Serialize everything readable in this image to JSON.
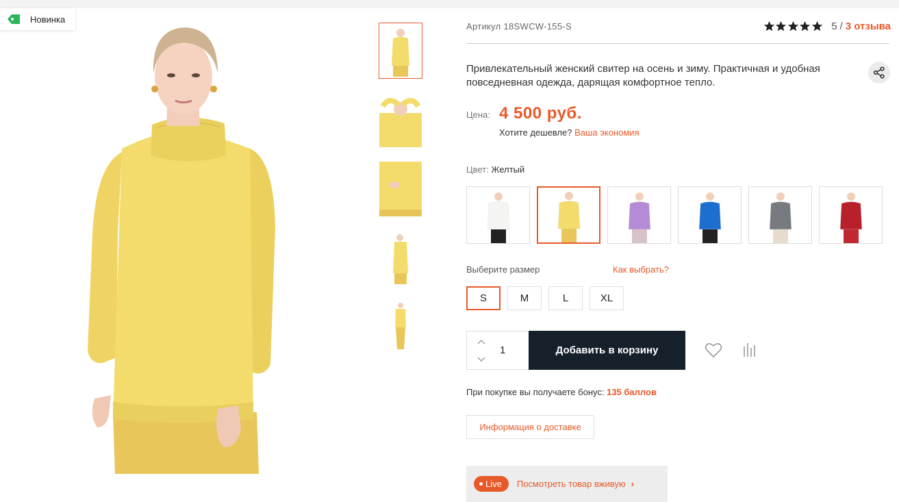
{
  "badge": {
    "label": "Новинка"
  },
  "product": {
    "sku": "Артикул 18SWCW-155-S",
    "rating": {
      "stars": 5,
      "score": "5",
      "separator": "/",
      "reviews": "3 отзыва"
    },
    "description": "Привлекательный женский свитер на осень и зиму. Практичная и удобная повседневная одежда, дарящая комфортное тепло.",
    "price_label": "Цена:",
    "price": "4 500 руб.",
    "cheaper_text": "Хотите дешевле?",
    "cheaper_link": "Ваша экономия",
    "color_label": "Цвет:",
    "color_value": "Желтый",
    "colors": [
      {
        "name": "white",
        "hex": "#f4f4f2",
        "active": false
      },
      {
        "name": "yellow",
        "hex": "#f3dc6b",
        "active": true
      },
      {
        "name": "lilac",
        "hex": "#b68ad6",
        "active": false
      },
      {
        "name": "blue",
        "hex": "#1d6fcf",
        "active": false
      },
      {
        "name": "grey",
        "hex": "#777a7e",
        "active": false
      },
      {
        "name": "red",
        "hex": "#b8202c",
        "active": false
      }
    ],
    "size_label": "Выберите размер",
    "size_guide": "Как выбрать?",
    "sizes": [
      "S",
      "M",
      "L",
      "XL"
    ],
    "selected_size": "S",
    "quantity": "1",
    "add_to_cart": "Добавить в корзину",
    "bonus_text": "При покупке вы получаете бонус:",
    "bonus_value": "135 баллов",
    "delivery_info": "Информация о доставке",
    "live_badge": "Live",
    "live_text": "Посмотреть товар вживую",
    "live_chevron": "›"
  },
  "colors": {
    "accent": "#e8592a",
    "button_dark": "#16202b",
    "sweater": "#f3dc6b"
  },
  "icons": [
    "tag-icon",
    "star-icon",
    "share-icon",
    "chevron-up-icon",
    "chevron-down-icon",
    "heart-icon",
    "compare-icon"
  ]
}
